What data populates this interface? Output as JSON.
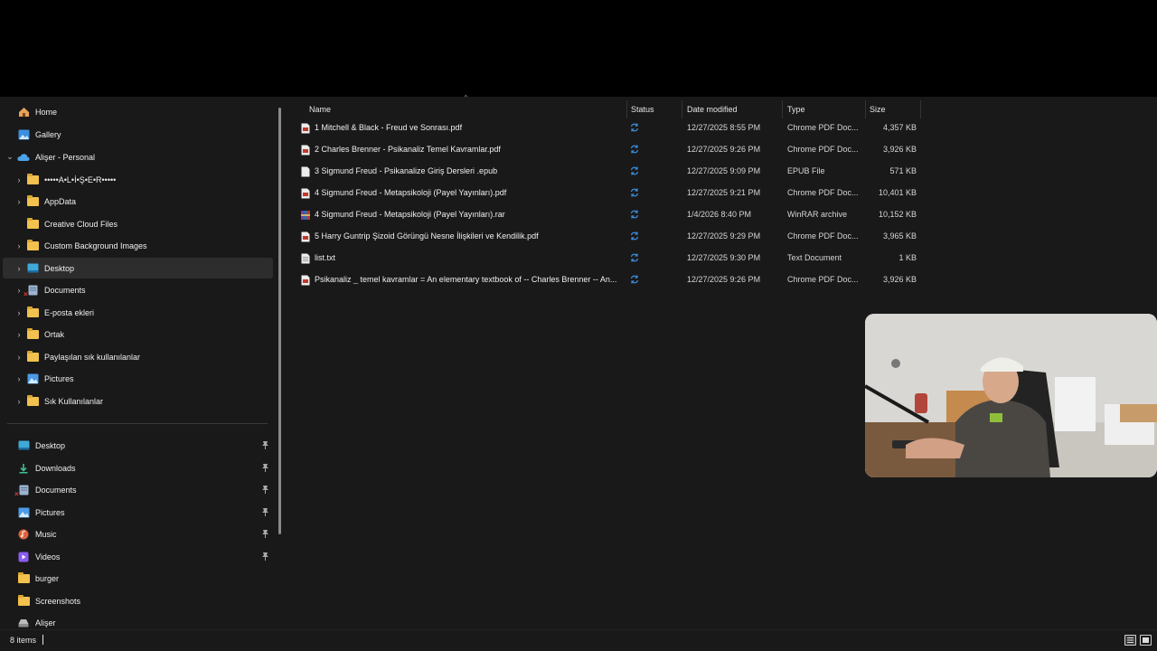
{
  "sidebar": {
    "quick_items": [
      {
        "label": "Home",
        "icon": "home-icon"
      },
      {
        "label": "Gallery",
        "icon": "gallery-icon"
      }
    ],
    "onedrive": {
      "label": "Alişer - Personal",
      "icon": "cloud-icon"
    },
    "onedrive_items": [
      {
        "label": "•••••A•L•İ•Ş•E•R•••••",
        "icon": "folder-icon"
      },
      {
        "label": "AppData",
        "icon": "folder-icon"
      },
      {
        "label": "Creative Cloud Files",
        "icon": "folder-icon"
      },
      {
        "label": "Custom Background Images",
        "icon": "folder-icon"
      },
      {
        "label": "Desktop",
        "icon": "desktop-icon"
      },
      {
        "label": "Documents",
        "icon": "documents-icon"
      },
      {
        "label": "E-posta ekleri",
        "icon": "folder-icon"
      },
      {
        "label": "Ortak",
        "icon": "folder-icon"
      },
      {
        "label": "Paylaşılan sık kullanılanlar",
        "icon": "folder-icon"
      },
      {
        "label": "Pictures",
        "icon": "pictures-icon"
      },
      {
        "label": "Sık Kullanılanlar",
        "icon": "folder-icon"
      }
    ],
    "pinned_items": [
      {
        "label": "Desktop",
        "icon": "desktop-icon"
      },
      {
        "label": "Downloads",
        "icon": "download-icon"
      },
      {
        "label": "Documents",
        "icon": "documents-icon"
      },
      {
        "label": "Pictures",
        "icon": "pictures-icon"
      },
      {
        "label": "Music",
        "icon": "music-icon"
      },
      {
        "label": "Videos",
        "icon": "videos-icon"
      },
      {
        "label": "burger",
        "icon": "folder-icon"
      },
      {
        "label": "Screenshots",
        "icon": "folder-icon"
      },
      {
        "label": "Alişer",
        "icon": "drive-icon"
      }
    ]
  },
  "columns": {
    "name": "Name",
    "status": "Status",
    "date_modified": "Date modified",
    "type": "Type",
    "size": "Size"
  },
  "files": [
    {
      "name": "1 Mitchell & Black - Freud ve Sonrası.pdf",
      "date": "12/27/2025 8:55 PM",
      "type": "Chrome PDF Doc...",
      "size": "4,357 KB",
      "icon": "pdf-icon"
    },
    {
      "name": "2 Charles Brenner - Psikanaliz Temel Kavramlar.pdf",
      "date": "12/27/2025 9:26 PM",
      "type": "Chrome PDF Doc...",
      "size": "3,926 KB",
      "icon": "pdf-icon"
    },
    {
      "name": "3 Sigmund Freud - Psikanalize Giriş Dersleri .epub",
      "date": "12/27/2025 9:09 PM",
      "type": "EPUB File",
      "size": "571 KB",
      "icon": "file-icon"
    },
    {
      "name": "4 Sigmund Freud - Metapsikoloji (Payel Yayınları).pdf",
      "date": "12/27/2025 9:21 PM",
      "type": "Chrome PDF Doc...",
      "size": "10,401 KB",
      "icon": "pdf-icon"
    },
    {
      "name": "4 Sigmund Freud - Metapsikoloji (Payel Yayınları).rar",
      "date": "1/4/2026 8:40 PM",
      "type": "WinRAR archive",
      "size": "10,152 KB",
      "icon": "rar-icon"
    },
    {
      "name": "5 Harry Guntrip Şizoid Görüngü Nesne İlişkileri ve Kendilik.pdf",
      "date": "12/27/2025 9:29 PM",
      "type": "Chrome PDF Doc...",
      "size": "3,965 KB",
      "icon": "pdf-icon"
    },
    {
      "name": "list.txt",
      "date": "12/27/2025 9:30 PM",
      "type": "Text Document",
      "size": "1 KB",
      "icon": "text-file-icon"
    },
    {
      "name": "Psikanaliz _ temel kavramlar = An elementary textbook of -- Charles Brenner -- An...",
      "date": "12/27/2025 9:26 PM",
      "type": "Chrome PDF Doc...",
      "size": "3,926 KB",
      "icon": "pdf-icon"
    }
  ],
  "status_bar": {
    "item_count": "8 items"
  },
  "colors": {
    "background": "#191919",
    "folder": "#f2c14e",
    "sync": "#3b8fe0",
    "onedrive": "#4aa3e8"
  }
}
